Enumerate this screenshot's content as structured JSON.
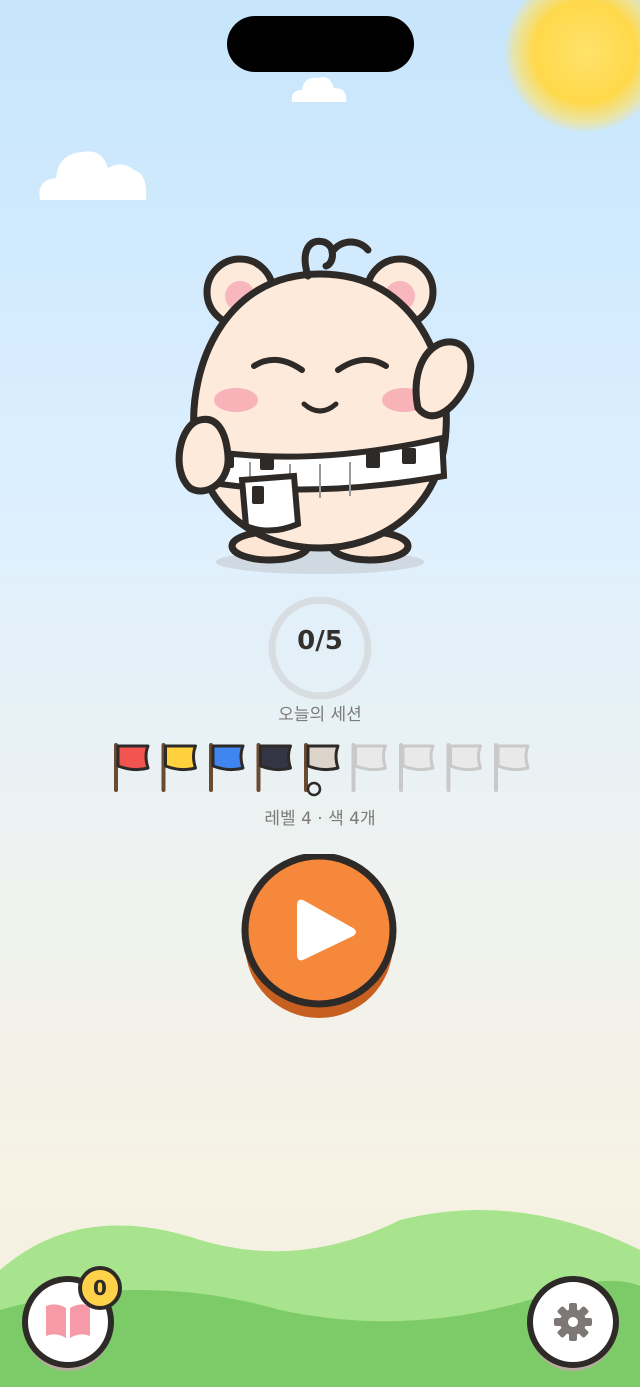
{
  "session": {
    "progress_text": "0/5",
    "completed": 0,
    "total": 5,
    "label": "오늘의 세션"
  },
  "level": {
    "label": "레벨 4 · 색 4개",
    "flags": [
      {
        "color": "#f2544f",
        "state": "unlocked"
      },
      {
        "color": "#ffd23d",
        "state": "unlocked"
      },
      {
        "color": "#3f86f0",
        "state": "unlocked"
      },
      {
        "color": "#333544",
        "state": "unlocked"
      },
      {
        "color": "#ddd5cb",
        "state": "current"
      },
      {
        "color": "#e9e9e9",
        "state": "locked"
      },
      {
        "color": "#e9e9e9",
        "state": "locked"
      },
      {
        "color": "#e9e9e9",
        "state": "locked"
      },
      {
        "color": "#e9e9e9",
        "state": "locked"
      }
    ]
  },
  "buttons": {
    "play_icon": "play-icon",
    "book_icon": "book-icon",
    "settings_icon": "gear-icon"
  },
  "book_badge": "0",
  "colors": {
    "accent": "#f5883a",
    "outline": "#2e2a28",
    "hill_light": "#a8e38e",
    "hill_dark": "#7ccb68"
  }
}
